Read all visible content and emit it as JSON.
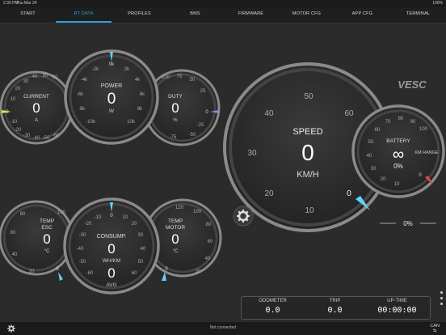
{
  "status": {
    "time": "2:30 PM",
    "date": "Thu Mar 24",
    "battery": "100%"
  },
  "tabs": [
    {
      "label": "START"
    },
    {
      "label": "RT DATA",
      "active": true
    },
    {
      "label": "PROFILES"
    },
    {
      "label": "BMS"
    },
    {
      "label": "FIRMWARE"
    },
    {
      "label": "MOTOR CFG"
    },
    {
      "label": "APP CFG"
    },
    {
      "label": "TERMINAL"
    }
  ],
  "gauges": {
    "current": {
      "title": "CURRENT",
      "value": "0",
      "unit": "A",
      "ticks": [
        "60",
        "50",
        "40",
        "30",
        "20",
        "10",
        "0",
        "-10",
        "-20",
        "-30",
        "-40",
        "-50",
        "-60"
      ],
      "min_label": "0"
    },
    "power": {
      "title": "POWER",
      "value": "0",
      "unit": "W",
      "ticks": [
        "0k",
        "2k",
        "4k",
        "6k",
        "8k",
        "10k",
        "-10k",
        "-8k",
        "-6k",
        "-4k",
        "-2k"
      ]
    },
    "duty": {
      "title": "DUTY",
      "value": "0",
      "unit": "%",
      "ticks": [
        "100",
        "75",
        "50",
        "25",
        "0",
        "-25",
        "-50",
        "-75",
        "-100"
      ],
      "min_label": "0"
    },
    "speed": {
      "title": "SPEED",
      "value": "0",
      "unit": "KM/H",
      "ticks": [
        "0",
        "10",
        "20",
        "30",
        "40",
        "50",
        "60"
      ],
      "min_label": "0"
    },
    "battery": {
      "title": "BATTERY",
      "value": "∞",
      "sub_label": "KM RANGE",
      "percent": "0%",
      "ticks": [
        "0",
        "10",
        "20",
        "30",
        "40",
        "50",
        "60",
        "70",
        "80",
        "90",
        "100"
      ],
      "min_label": "0"
    },
    "temp_esc": {
      "title": "TEMP",
      "title2": "ESC",
      "value": "0",
      "unit": "°C",
      "ticks": [
        "0",
        "20",
        "40",
        "60",
        "80",
        "100"
      ],
      "min_label": "0"
    },
    "consumption": {
      "title": "CONSUMP.",
      "value": "0",
      "unit": "WH/KM",
      "avg_value": "0",
      "avg_label": "AVG",
      "ticks": [
        "0",
        "10",
        "20",
        "30",
        "40",
        "50",
        "60",
        "-60",
        "-50",
        "-40",
        "-30",
        "-20",
        "-10"
      ]
    },
    "temp_motor": {
      "title": "TEMP",
      "title2": "MOTOR",
      "value": "0",
      "unit": "°C",
      "ticks": [
        "0",
        "20",
        "40",
        "60",
        "80",
        "100",
        "120"
      ],
      "min_label": "0"
    }
  },
  "side_percent": "0%",
  "logo_text": "VESC",
  "trip": {
    "odometer_label": "ODOMETER",
    "odometer": "0.0",
    "trip_label": "TRIP",
    "trip": "0.0",
    "uptime_label": "UP-TIME",
    "uptime": "00:00:00"
  },
  "bottom": {
    "status": "Not connected",
    "can": "CAN"
  },
  "colors": {
    "accent": "#2aa3d8",
    "cyan_needle": "#5fd3f5",
    "red_needle": "#e8413a",
    "yellow_mark": "#e6e04a",
    "purple_mark": "#b07ad8"
  }
}
